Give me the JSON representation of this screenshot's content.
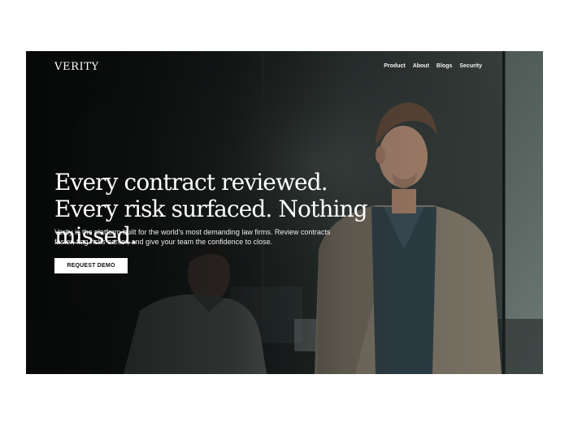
{
  "brand": {
    "logo_text": "VERITY"
  },
  "nav": {
    "links": [
      {
        "label": "Product"
      },
      {
        "label": "About"
      },
      {
        "label": "Blogs"
      },
      {
        "label": "Security"
      }
    ]
  },
  "hero": {
    "headline": "Every contract reviewed. Every risk surfaced. Nothing missed.",
    "subheadline": "Verity is the  platform built for the world's most demanding law firms. Review contracts faster, flag risks earlier, and give your team the confidence to close.",
    "cta_label": "REQUEST DEMO",
    "background_image": "office-professionals-photo"
  },
  "colors": {
    "text_primary": "#ffffff",
    "cta_background": "#ffffff",
    "cta_text": "#111111",
    "page_background": "#ffffff"
  }
}
